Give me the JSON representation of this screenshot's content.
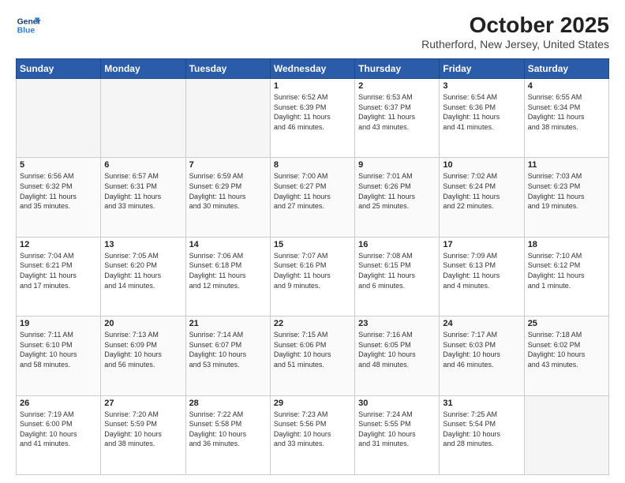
{
  "header": {
    "logo_line1": "General",
    "logo_line2": "Blue",
    "month": "October 2025",
    "location": "Rutherford, New Jersey, United States"
  },
  "weekdays": [
    "Sunday",
    "Monday",
    "Tuesday",
    "Wednesday",
    "Thursday",
    "Friday",
    "Saturday"
  ],
  "weeks": [
    [
      {
        "day": "",
        "content": ""
      },
      {
        "day": "",
        "content": ""
      },
      {
        "day": "",
        "content": ""
      },
      {
        "day": "1",
        "content": "Sunrise: 6:52 AM\nSunset: 6:39 PM\nDaylight: 11 hours\nand 46 minutes."
      },
      {
        "day": "2",
        "content": "Sunrise: 6:53 AM\nSunset: 6:37 PM\nDaylight: 11 hours\nand 43 minutes."
      },
      {
        "day": "3",
        "content": "Sunrise: 6:54 AM\nSunset: 6:36 PM\nDaylight: 11 hours\nand 41 minutes."
      },
      {
        "day": "4",
        "content": "Sunrise: 6:55 AM\nSunset: 6:34 PM\nDaylight: 11 hours\nand 38 minutes."
      }
    ],
    [
      {
        "day": "5",
        "content": "Sunrise: 6:56 AM\nSunset: 6:32 PM\nDaylight: 11 hours\nand 35 minutes."
      },
      {
        "day": "6",
        "content": "Sunrise: 6:57 AM\nSunset: 6:31 PM\nDaylight: 11 hours\nand 33 minutes."
      },
      {
        "day": "7",
        "content": "Sunrise: 6:59 AM\nSunset: 6:29 PM\nDaylight: 11 hours\nand 30 minutes."
      },
      {
        "day": "8",
        "content": "Sunrise: 7:00 AM\nSunset: 6:27 PM\nDaylight: 11 hours\nand 27 minutes."
      },
      {
        "day": "9",
        "content": "Sunrise: 7:01 AM\nSunset: 6:26 PM\nDaylight: 11 hours\nand 25 minutes."
      },
      {
        "day": "10",
        "content": "Sunrise: 7:02 AM\nSunset: 6:24 PM\nDaylight: 11 hours\nand 22 minutes."
      },
      {
        "day": "11",
        "content": "Sunrise: 7:03 AM\nSunset: 6:23 PM\nDaylight: 11 hours\nand 19 minutes."
      }
    ],
    [
      {
        "day": "12",
        "content": "Sunrise: 7:04 AM\nSunset: 6:21 PM\nDaylight: 11 hours\nand 17 minutes."
      },
      {
        "day": "13",
        "content": "Sunrise: 7:05 AM\nSunset: 6:20 PM\nDaylight: 11 hours\nand 14 minutes."
      },
      {
        "day": "14",
        "content": "Sunrise: 7:06 AM\nSunset: 6:18 PM\nDaylight: 11 hours\nand 12 minutes."
      },
      {
        "day": "15",
        "content": "Sunrise: 7:07 AM\nSunset: 6:16 PM\nDaylight: 11 hours\nand 9 minutes."
      },
      {
        "day": "16",
        "content": "Sunrise: 7:08 AM\nSunset: 6:15 PM\nDaylight: 11 hours\nand 6 minutes."
      },
      {
        "day": "17",
        "content": "Sunrise: 7:09 AM\nSunset: 6:13 PM\nDaylight: 11 hours\nand 4 minutes."
      },
      {
        "day": "18",
        "content": "Sunrise: 7:10 AM\nSunset: 6:12 PM\nDaylight: 11 hours\nand 1 minute."
      }
    ],
    [
      {
        "day": "19",
        "content": "Sunrise: 7:11 AM\nSunset: 6:10 PM\nDaylight: 10 hours\nand 58 minutes."
      },
      {
        "day": "20",
        "content": "Sunrise: 7:13 AM\nSunset: 6:09 PM\nDaylight: 10 hours\nand 56 minutes."
      },
      {
        "day": "21",
        "content": "Sunrise: 7:14 AM\nSunset: 6:07 PM\nDaylight: 10 hours\nand 53 minutes."
      },
      {
        "day": "22",
        "content": "Sunrise: 7:15 AM\nSunset: 6:06 PM\nDaylight: 10 hours\nand 51 minutes."
      },
      {
        "day": "23",
        "content": "Sunrise: 7:16 AM\nSunset: 6:05 PM\nDaylight: 10 hours\nand 48 minutes."
      },
      {
        "day": "24",
        "content": "Sunrise: 7:17 AM\nSunset: 6:03 PM\nDaylight: 10 hours\nand 46 minutes."
      },
      {
        "day": "25",
        "content": "Sunrise: 7:18 AM\nSunset: 6:02 PM\nDaylight: 10 hours\nand 43 minutes."
      }
    ],
    [
      {
        "day": "26",
        "content": "Sunrise: 7:19 AM\nSunset: 6:00 PM\nDaylight: 10 hours\nand 41 minutes."
      },
      {
        "day": "27",
        "content": "Sunrise: 7:20 AM\nSunset: 5:59 PM\nDaylight: 10 hours\nand 38 minutes."
      },
      {
        "day": "28",
        "content": "Sunrise: 7:22 AM\nSunset: 5:58 PM\nDaylight: 10 hours\nand 36 minutes."
      },
      {
        "day": "29",
        "content": "Sunrise: 7:23 AM\nSunset: 5:56 PM\nDaylight: 10 hours\nand 33 minutes."
      },
      {
        "day": "30",
        "content": "Sunrise: 7:24 AM\nSunset: 5:55 PM\nDaylight: 10 hours\nand 31 minutes."
      },
      {
        "day": "31",
        "content": "Sunrise: 7:25 AM\nSunset: 5:54 PM\nDaylight: 10 hours\nand 28 minutes."
      },
      {
        "day": "",
        "content": ""
      }
    ]
  ]
}
